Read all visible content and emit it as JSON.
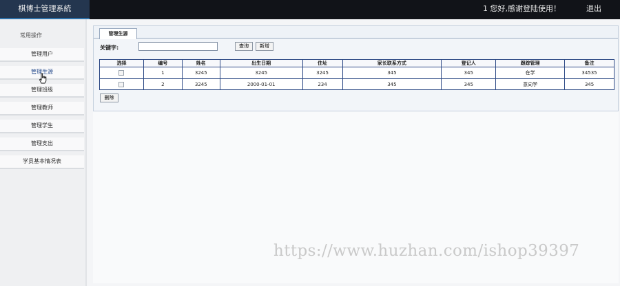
{
  "header": {
    "title": "棋博士管理系統",
    "welcome": "1 您好,感谢登陆使用！",
    "logout_label": "退出"
  },
  "sidebar": {
    "title": "常用操作",
    "items": [
      {
        "label": "管理用户"
      },
      {
        "label": "管理生源"
      },
      {
        "label": "管理班级"
      },
      {
        "label": "管理教师"
      },
      {
        "label": "管理学生"
      },
      {
        "label": "管理支出"
      },
      {
        "label": "学员基本情况表"
      }
    ]
  },
  "main": {
    "tab_label": "管理生源",
    "search": {
      "label": "关键字:",
      "value": ""
    },
    "query_label": "查询",
    "add_label": "新增",
    "delete_label": "删除",
    "table": {
      "headers": [
        "选择",
        "编号",
        "姓名",
        "出生日期",
        "住址",
        "家长联系方式",
        "登记人",
        "跟踪管理",
        "备注"
      ],
      "rows": [
        [
          "",
          "1",
          "3245",
          "3245",
          "3245",
          "345",
          "345",
          "在学",
          "34535"
        ],
        [
          "",
          "2",
          "3245",
          "2000-01-01",
          "234",
          "345",
          "345",
          "意向学",
          "345"
        ]
      ]
    }
  },
  "watermark": "https://www.huzhan.com/ishop39397"
}
